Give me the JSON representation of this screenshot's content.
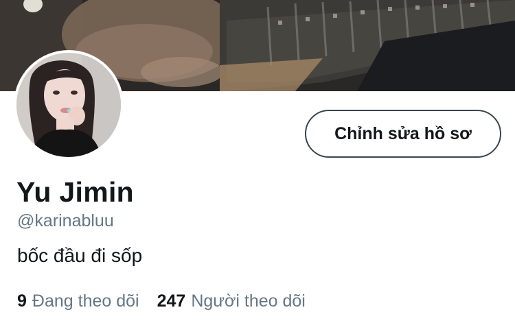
{
  "profile": {
    "display_name": "Yu Jimin",
    "handle": "@karinabluu",
    "bio": "bốc đầu đi sốp"
  },
  "actions": {
    "edit_profile_label": "Chỉnh sửa hồ sơ"
  },
  "stats": {
    "following_count": "9",
    "following_label": "Đang theo dõi",
    "followers_count": "247",
    "followers_label": "Người theo dõi"
  },
  "colors": {
    "text_primary": "#14171a",
    "text_secondary": "#657786",
    "button_border": "#38444d"
  }
}
